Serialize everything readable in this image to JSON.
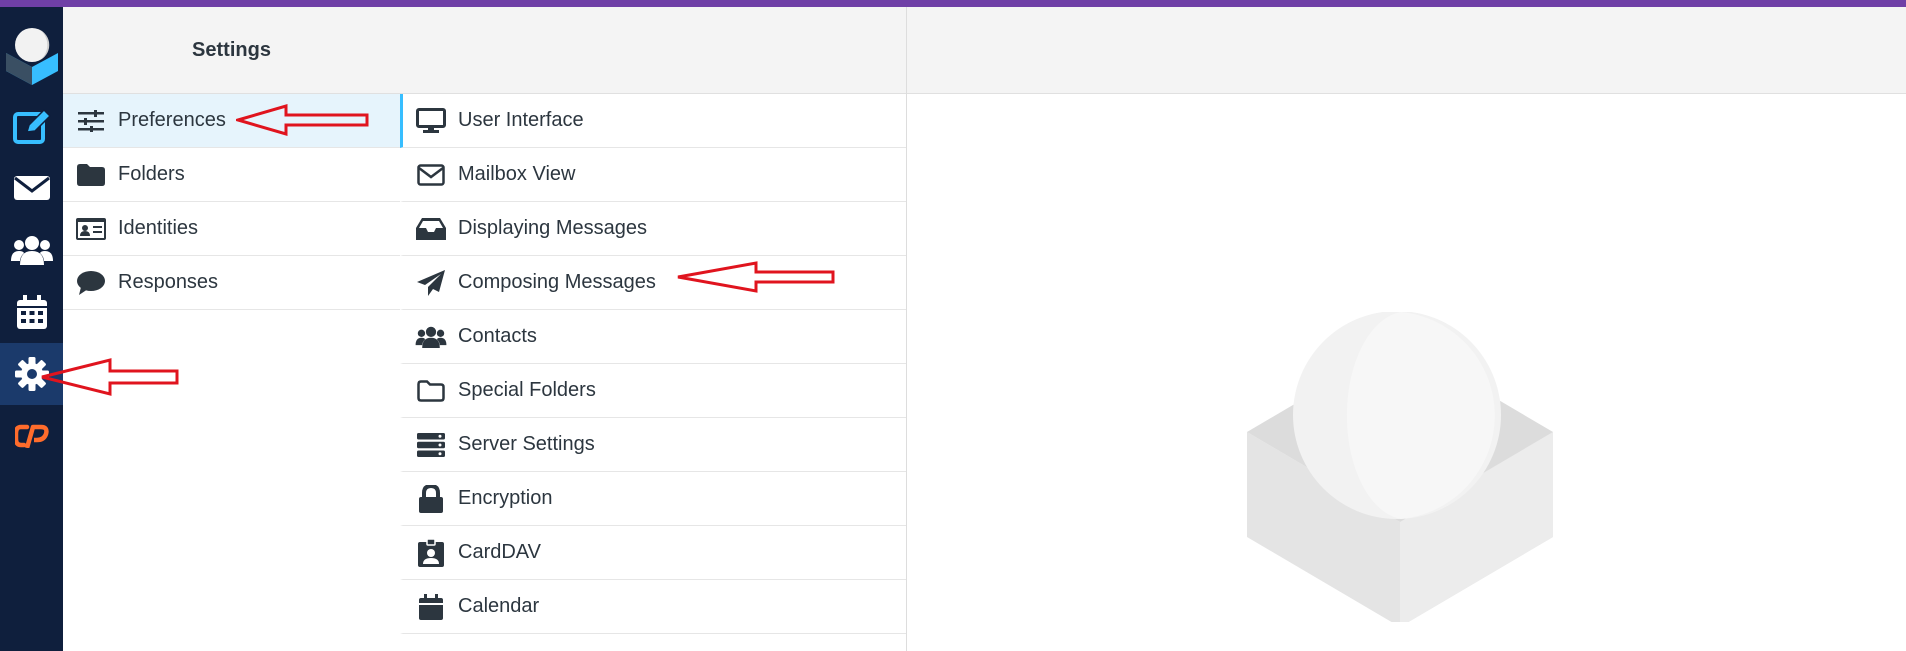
{
  "colors": {
    "rail_bg": "#0f1f3d",
    "accent": "#37beff",
    "active_rail": "#1b3a6b",
    "arrow": "#e0141e",
    "cpanel": "#ff6c2c"
  },
  "rail": {
    "items": [
      {
        "name": "compose",
        "icon": "compose-icon"
      },
      {
        "name": "mail",
        "icon": "envelope-icon"
      },
      {
        "name": "contacts",
        "icon": "users-icon"
      },
      {
        "name": "calendar",
        "icon": "calendar-icon"
      },
      {
        "name": "settings",
        "icon": "gear-icon",
        "active": true
      },
      {
        "name": "cpanel",
        "icon": "cpanel-icon"
      }
    ]
  },
  "settings": {
    "title": "Settings",
    "items": [
      {
        "label": "Preferences",
        "icon": "sliders-icon",
        "selected": true
      },
      {
        "label": "Folders",
        "icon": "folder-icon"
      },
      {
        "label": "Identities",
        "icon": "id-card-icon"
      },
      {
        "label": "Responses",
        "icon": "comment-icon"
      }
    ]
  },
  "preferences": {
    "items": [
      {
        "label": "User Interface",
        "icon": "monitor-icon",
        "selected": true
      },
      {
        "label": "Mailbox View",
        "icon": "envelope-outline-icon"
      },
      {
        "label": "Displaying Messages",
        "icon": "inbox-icon"
      },
      {
        "label": "Composing Messages",
        "icon": "paper-plane-icon"
      },
      {
        "label": "Contacts",
        "icon": "users-icon"
      },
      {
        "label": "Special Folders",
        "icon": "folder-outline-icon"
      },
      {
        "label": "Server Settings",
        "icon": "server-icon"
      },
      {
        "label": "Encryption",
        "icon": "lock-icon"
      },
      {
        "label": "CardDAV",
        "icon": "contact-badge-icon"
      },
      {
        "label": "Calendar",
        "icon": "calendar-icon"
      }
    ]
  }
}
